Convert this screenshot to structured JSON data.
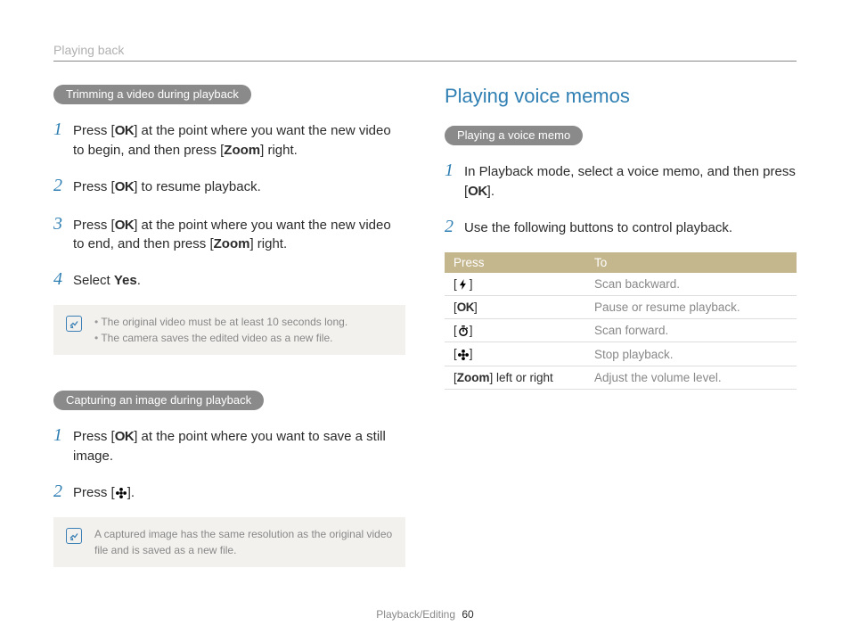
{
  "header": {
    "section": "Playing back"
  },
  "left": {
    "pill1": "Trimming a video during playback",
    "steps1": [
      {
        "n": "1",
        "pre": "Press [",
        "ok": true,
        "post": "] at the point where you want the new video to begin, and then press [",
        "bold": "Zoom",
        "tail": "] right."
      },
      {
        "n": "2",
        "pre": "Press [",
        "ok": true,
        "post": "] to resume playback."
      },
      {
        "n": "3",
        "pre": "Press [",
        "ok": true,
        "post": "] at the point where you want the new video to end, and then press [",
        "bold": "Zoom",
        "tail": "] right."
      },
      {
        "n": "4",
        "plain_pre": "Select ",
        "bold": "Yes",
        "plain_post": "."
      }
    ],
    "note1": [
      "The original video must be at least 10 seconds long.",
      "The camera saves the edited video as a new file."
    ],
    "pill2": "Capturing an image during playback",
    "steps2": [
      {
        "n": "1",
        "pre": "Press [",
        "ok": true,
        "post": "] at the point where you want to save a still image."
      },
      {
        "n": "2",
        "pre": "Press [",
        "icon": "flower",
        "post": "]."
      }
    ],
    "note2": "A captured image has the same resolution as the original video file and is saved as a new file."
  },
  "right": {
    "title": "Playing voice memos",
    "pill": "Playing a voice memo",
    "steps": [
      {
        "n": "1",
        "pre": "In Playback mode, select a voice memo, and then press [",
        "ok": true,
        "post": "]."
      },
      {
        "n": "2",
        "plain": "Use the following buttons to control playback."
      }
    ],
    "table": {
      "head": [
        "Press",
        "To"
      ],
      "rows": [
        {
          "icon": "flash",
          "desc": "Scan backward."
        },
        {
          "icon": "ok",
          "desc": "Pause or resume playback."
        },
        {
          "icon": "timer",
          "desc": "Scan forward."
        },
        {
          "icon": "flower",
          "desc": "Stop playback."
        },
        {
          "label_pre": "[",
          "label_bold": "Zoom",
          "label_post": "] left or right",
          "desc": "Adjust the volume level."
        }
      ]
    }
  },
  "footer": {
    "section": "Playback/Editing",
    "page": "60"
  }
}
